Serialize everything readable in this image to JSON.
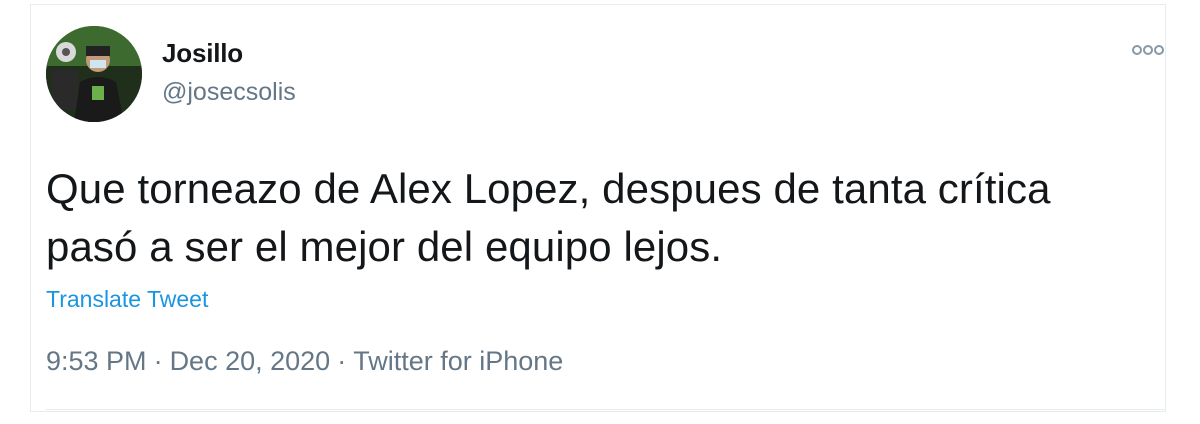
{
  "tweet": {
    "author": {
      "display_name": "Josillo",
      "handle": "@josecsolis",
      "avatar_icon": "profile-photo"
    },
    "more_icon": "more-options-icon",
    "text_lines": [
      "Que torneazo de Alex Lopez, despues de tanta crítica",
      "pasó a ser el mejor del equipo lejos."
    ],
    "translate_label": "Translate Tweet",
    "time": "9:53 PM",
    "date": "Dec 20, 2020",
    "separator": "·",
    "source": "Twitter for iPhone"
  },
  "colors": {
    "text_primary": "#14171a",
    "text_secondary": "#657786",
    "link": "#1b95e0",
    "border": "#e6ecf0"
  }
}
